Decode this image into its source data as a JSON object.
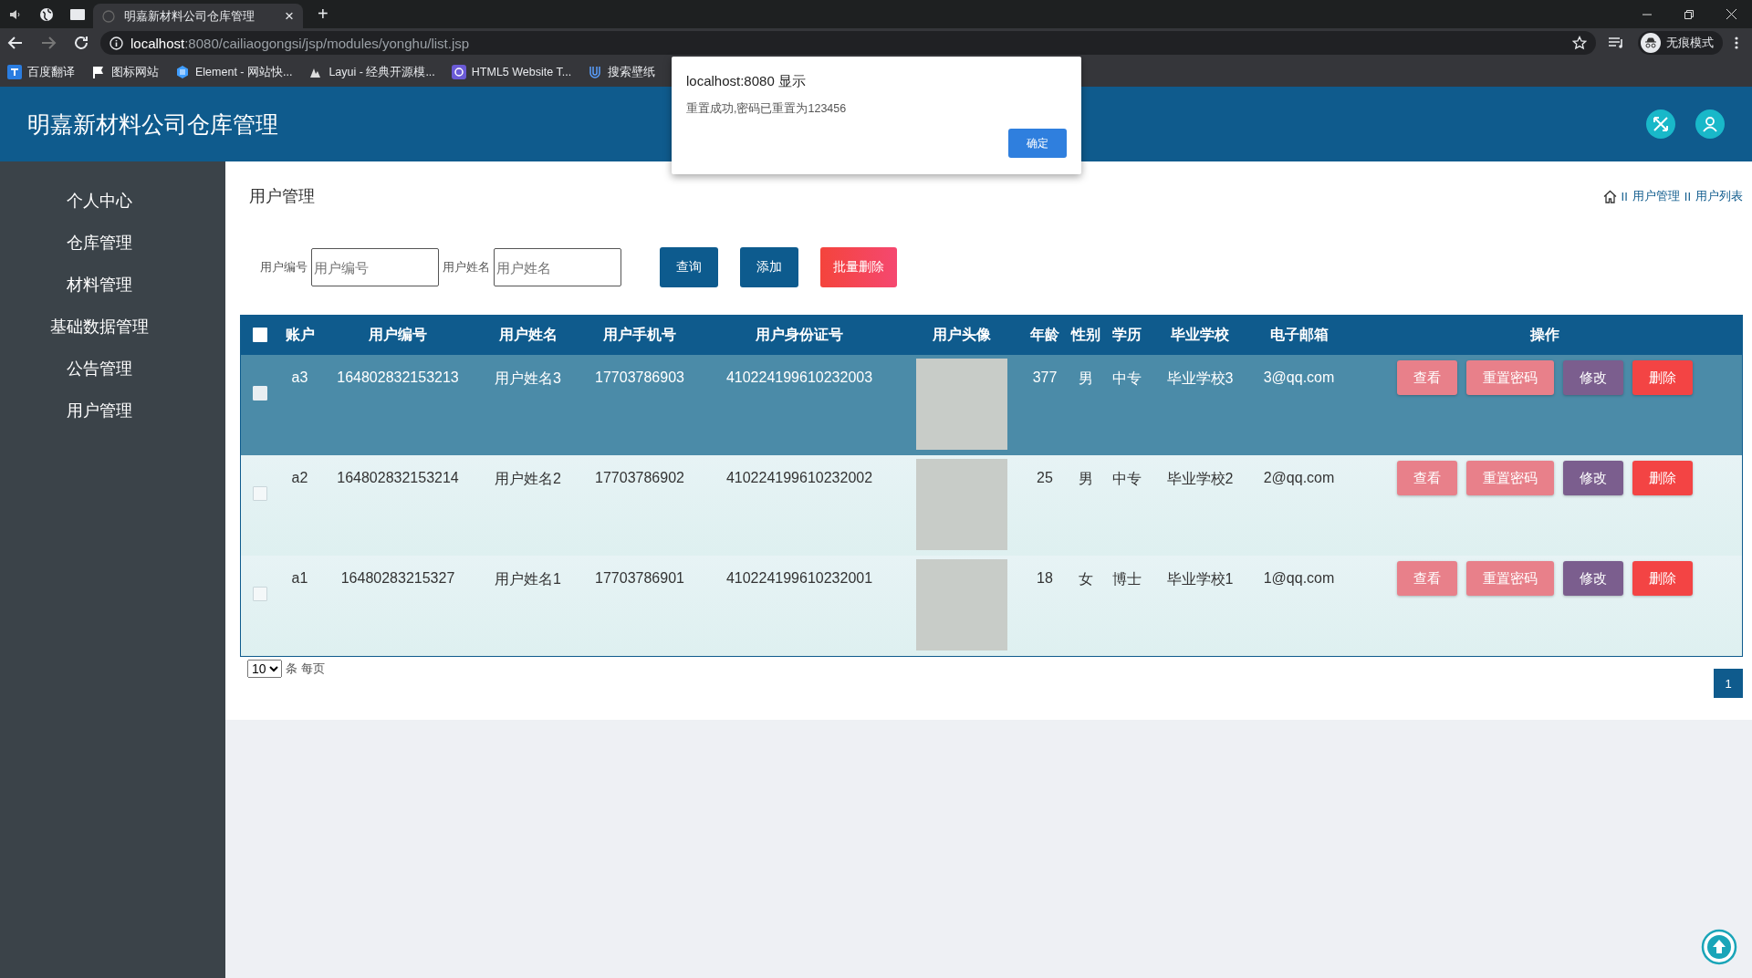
{
  "browser": {
    "tab": {
      "title": "明嘉新材料公司仓库管理",
      "close": "×"
    },
    "new_tab": "+",
    "address": {
      "host": "localhost",
      "path": ":8080/cailiaogongsi/jsp/modules/yonghu/list.jsp"
    },
    "profile": "无痕模式",
    "bookmarks": [
      {
        "label": "百度翻译"
      },
      {
        "label": "图标网站"
      },
      {
        "label": "Element - 网站快..."
      },
      {
        "label": "Layui - 经典开源模..."
      },
      {
        "label": "HTML5 Website T..."
      },
      {
        "label": "搜索壁纸"
      }
    ]
  },
  "app": {
    "title": "明嘉新材料公司仓库管理"
  },
  "sidebar": {
    "items": [
      {
        "label": "个人中心"
      },
      {
        "label": "仓库管理"
      },
      {
        "label": "材料管理"
      },
      {
        "label": "基础数据管理"
      },
      {
        "label": "公告管理"
      },
      {
        "label": "用户管理"
      }
    ]
  },
  "page": {
    "title": "用户管理",
    "breadcrumb": [
      {
        "separator": "II",
        "label": "用户管理"
      },
      {
        "separator": "II",
        "label": "用户列表"
      }
    ]
  },
  "search": {
    "fields": [
      {
        "label": "用户编号",
        "placeholder": "用户编号"
      },
      {
        "label": "用户姓名",
        "placeholder": "用户姓名"
      }
    ],
    "buttons": [
      {
        "label": "查询",
        "kind": "primary"
      },
      {
        "label": "添加",
        "kind": "primary"
      },
      {
        "label": "批量删除",
        "kind": "danger"
      }
    ]
  },
  "table": {
    "select_all_checked": false,
    "columns": [
      "账户",
      "用户编号",
      "用户姓名",
      "用户手机号",
      "用户身份证号",
      "用户头像",
      "年龄",
      "性别",
      "学历",
      "毕业学校",
      "电子邮箱",
      "操作"
    ],
    "rows": [
      {
        "selected": true,
        "checked": false,
        "cells": [
          "a3",
          "164802832153213",
          "用户姓名3",
          "17703786903",
          "410224199610232003",
          "",
          "377",
          "男",
          "中专",
          "毕业学校3",
          "3@qq.com"
        ],
        "actions": [
          {
            "label": "查看",
            "kind": "view"
          },
          {
            "label": "重置密码",
            "kind": "reset"
          },
          {
            "label": "修改",
            "kind": "edit"
          },
          {
            "label": "删除",
            "kind": "delete"
          }
        ]
      },
      {
        "selected": false,
        "checked": false,
        "cells": [
          "a2",
          "164802832153214",
          "用户姓名2",
          "17703786902",
          "410224199610232002",
          "",
          "25",
          "男",
          "中专",
          "毕业学校2",
          "2@qq.com"
        ],
        "actions": [
          {
            "label": "查看",
            "kind": "view"
          },
          {
            "label": "重置密码",
            "kind": "reset"
          },
          {
            "label": "修改",
            "kind": "edit"
          },
          {
            "label": "删除",
            "kind": "delete"
          }
        ]
      },
      {
        "selected": false,
        "checked": false,
        "cells": [
          "a1",
          "16480283215327",
          "用户姓名1",
          "17703786901",
          "410224199610232001",
          "",
          "18",
          "女",
          "博士",
          "毕业学校1",
          "1@qq.com"
        ],
        "actions": [
          {
            "label": "查看",
            "kind": "view"
          },
          {
            "label": "重置密码",
            "kind": "reset"
          },
          {
            "label": "修改",
            "kind": "edit"
          },
          {
            "label": "删除",
            "kind": "delete"
          }
        ]
      }
    ]
  },
  "pagination": {
    "page_size": "10",
    "page_size_label": "条 每页",
    "pages": [
      {
        "label": "1",
        "selected": true
      }
    ]
  },
  "dialog": {
    "title": "localhost:8080 显示",
    "message": "重置成功,密码已重置为123456",
    "button": "确定"
  }
}
